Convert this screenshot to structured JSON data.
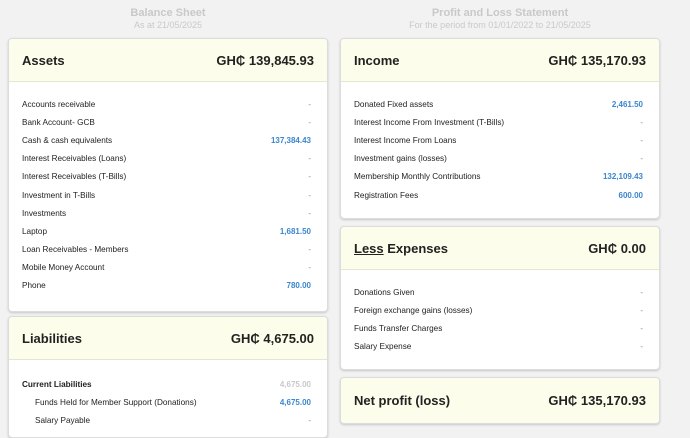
{
  "balance_sheet": {
    "title": "Balance Sheet",
    "subtitle": "As at 21/05/2025"
  },
  "profit_loss": {
    "title": "Profit and Loss Statement",
    "subtitle": "For the period from 01/01/2022 to 21/05/2025"
  },
  "assets": {
    "title": "Assets",
    "total": "GH₵ 139,845.93",
    "rows": [
      {
        "label": "Accounts receivable",
        "value": "-"
      },
      {
        "label": "Bank Account- GCB",
        "value": "-"
      },
      {
        "label": "Cash & cash equivalents",
        "value": "137,384.43"
      },
      {
        "label": "Interest Receivables (Loans)",
        "value": "-"
      },
      {
        "label": "Interest Receivables (T-Bills)",
        "value": "-"
      },
      {
        "label": "Investment in T-Bills",
        "value": "-"
      },
      {
        "label": "Investments",
        "value": "-"
      },
      {
        "label": "Laptop",
        "value": "1,681.50"
      },
      {
        "label": "Loan Receivables - Members",
        "value": "-"
      },
      {
        "label": "Mobile Money Account",
        "value": "-"
      },
      {
        "label": "Phone",
        "value": "780.00"
      }
    ]
  },
  "liabilities": {
    "title": "Liabilities",
    "total": "GH₵ 4,675.00",
    "rows": [
      {
        "label": "Current Liabilities",
        "value": "4,675.00"
      },
      {
        "label": "Funds Held for Member Support (Donations)",
        "value": "4,675.00"
      },
      {
        "label": "Salary Payable",
        "value": "-"
      }
    ]
  },
  "income": {
    "title": "Income",
    "total": "GH₵ 135,170.93",
    "rows": [
      {
        "label": "Donated Fixed assets",
        "value": "2,461.50"
      },
      {
        "label": "Interest Income From Investment (T-Bills)",
        "value": "-"
      },
      {
        "label": "Interest Income From Loans",
        "value": "-"
      },
      {
        "label": "Investment gains (losses)",
        "value": "-"
      },
      {
        "label": "Membership Monthly Contributions",
        "value": "132,109.43"
      },
      {
        "label": "Registration Fees",
        "value": "600.00"
      }
    ]
  },
  "expenses": {
    "title_prefix": "Less",
    "title_rest": " Expenses",
    "total": "GH₵ 0.00",
    "rows": [
      {
        "label": "Donations Given",
        "value": "-"
      },
      {
        "label": "Foreign exchange gains (losses)",
        "value": "-"
      },
      {
        "label": "Funds Transfer Charges",
        "value": "-"
      },
      {
        "label": "Salary Expense",
        "value": "-"
      }
    ]
  },
  "net_profit": {
    "title": "Net profit (loss)",
    "total": "GH₵ 135,170.93"
  },
  "colors": {
    "value_blue": "#3b86d0",
    "header_bg": "#fdfdeb"
  }
}
